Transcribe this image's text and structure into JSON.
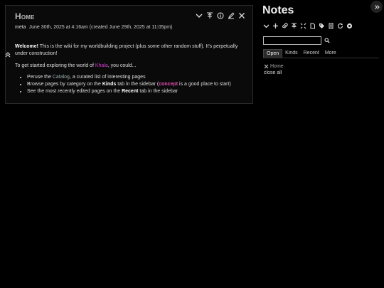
{
  "tiddler": {
    "title": "Home",
    "modifier": "meta",
    "subtitle_dates": "June 30th, 2025 at 4:16am (created June 29th, 2025 at 11:05pm)",
    "welcome_bold": "Welcome!",
    "welcome_rest": " This is the wiki for my worldbuilding project (plus some other random stuff). It's perpetually under construction!",
    "intro_pre": "To get started exploring the world of ",
    "intro_link": "Khala",
    "intro_post": ", you could...",
    "bullets": {
      "b1_pre": "Peruse the ",
      "b1_link": "Catalog",
      "b1_post": ", a curated list of interesting pages",
      "b2_pre": "Browse pages by category on the ",
      "b2_bold": "Kinds",
      "b2_mid": " tab in the sidebar (",
      "b2_tag": "concept",
      "b2_post": " is a good place to start)",
      "b3_pre": "See the most recently edited pages on the ",
      "b3_bold": "Recent",
      "b3_post": " tab in the sidebar"
    },
    "controls": [
      "chevron-down-icon",
      "fold-others-icon",
      "info-icon",
      "edit-icon",
      "close-icon"
    ]
  },
  "sidebar": {
    "title": "Notes",
    "toolbar_icons": [
      "chevron-down-icon",
      "new-tiddler-icon",
      "attach-icon",
      "fold-all-icon",
      "unfold-all-icon",
      "new-journal-icon",
      "tag-icon",
      "page-icon",
      "refresh-icon",
      "palette-icon"
    ],
    "search": {
      "value": "",
      "placeholder": ""
    },
    "tabs": [
      "Open",
      "Kinds",
      "Recent",
      "More"
    ],
    "active_tab": "Open",
    "open_items": [
      "Home"
    ],
    "close_all": "close all"
  },
  "colors": {
    "background": "#000000",
    "card": "#0a0a0a",
    "link_khala": "#d33ad0",
    "tag_concept": "#e34ab0"
  }
}
